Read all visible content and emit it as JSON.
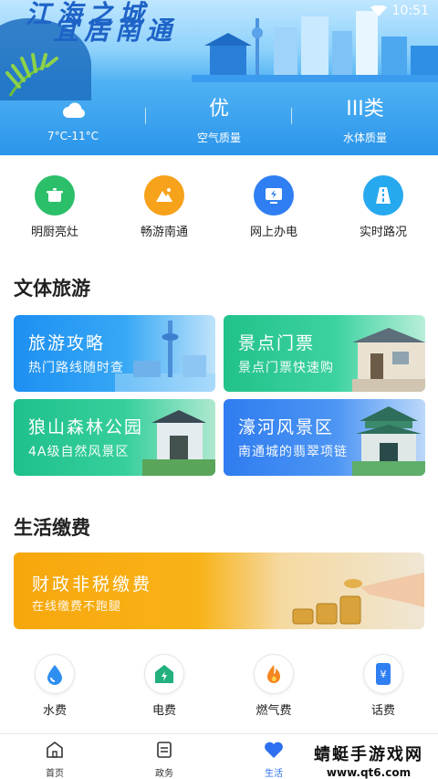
{
  "status_bar": {
    "time": "10:51"
  },
  "header": {
    "slogan_line1": "江海之城",
    "slogan_line2": "宜居南通",
    "weather": {
      "temperature": "7°C-11°C",
      "icon": "cloudy-icon"
    },
    "air": {
      "value": "优",
      "label": "空气质量"
    },
    "water": {
      "value": "III类",
      "label": "水体质量"
    }
  },
  "quick_services": [
    {
      "label": "明厨亮灶",
      "icon": "pot-icon",
      "color": "#2bbf6a"
    },
    {
      "label": "畅游南通",
      "icon": "mountain-icon",
      "color": "#f7a21b"
    },
    {
      "label": "网上办电",
      "icon": "power-monitor-icon",
      "color": "#2f7ff2"
    },
    {
      "label": "实时路况",
      "icon": "road-icon",
      "color": "#27a9ef"
    }
  ],
  "culture_section": {
    "title": "文体旅游",
    "cards": [
      {
        "title": "旅游攻略",
        "subtitle": "热门路线随时查"
      },
      {
        "title": "景点门票",
        "subtitle": "景点门票快速购"
      },
      {
        "title": "狼山森林公园",
        "subtitle": "4A级自然风景区"
      },
      {
        "title": "濠河风景区",
        "subtitle": "南通城的翡翠项链"
      }
    ]
  },
  "life_section": {
    "title": "生活缴费",
    "banner": {
      "title": "财政非税缴费",
      "subtitle": "在线缴费不跑腿"
    },
    "payments": [
      {
        "label": "水费",
        "icon": "water-drop-icon"
      },
      {
        "label": "电费",
        "icon": "electric-house-icon"
      },
      {
        "label": "燃气费",
        "icon": "flame-icon"
      },
      {
        "label": "话费",
        "icon": "phone-bill-icon"
      }
    ]
  },
  "tabs": [
    {
      "label": "首页",
      "icon": "home-icon"
    },
    {
      "label": "政务",
      "icon": "document-icon"
    },
    {
      "label": "生活",
      "icon": "heart-icon",
      "active": true
    }
  ],
  "watermark": {
    "line1": "蜻蜓手游戏网",
    "line2": "www.qt6.com"
  },
  "colors": {
    "accent": "#2d6ff0",
    "header_blue": "#3fa6f2",
    "fee_orange": "#f7a70c"
  }
}
